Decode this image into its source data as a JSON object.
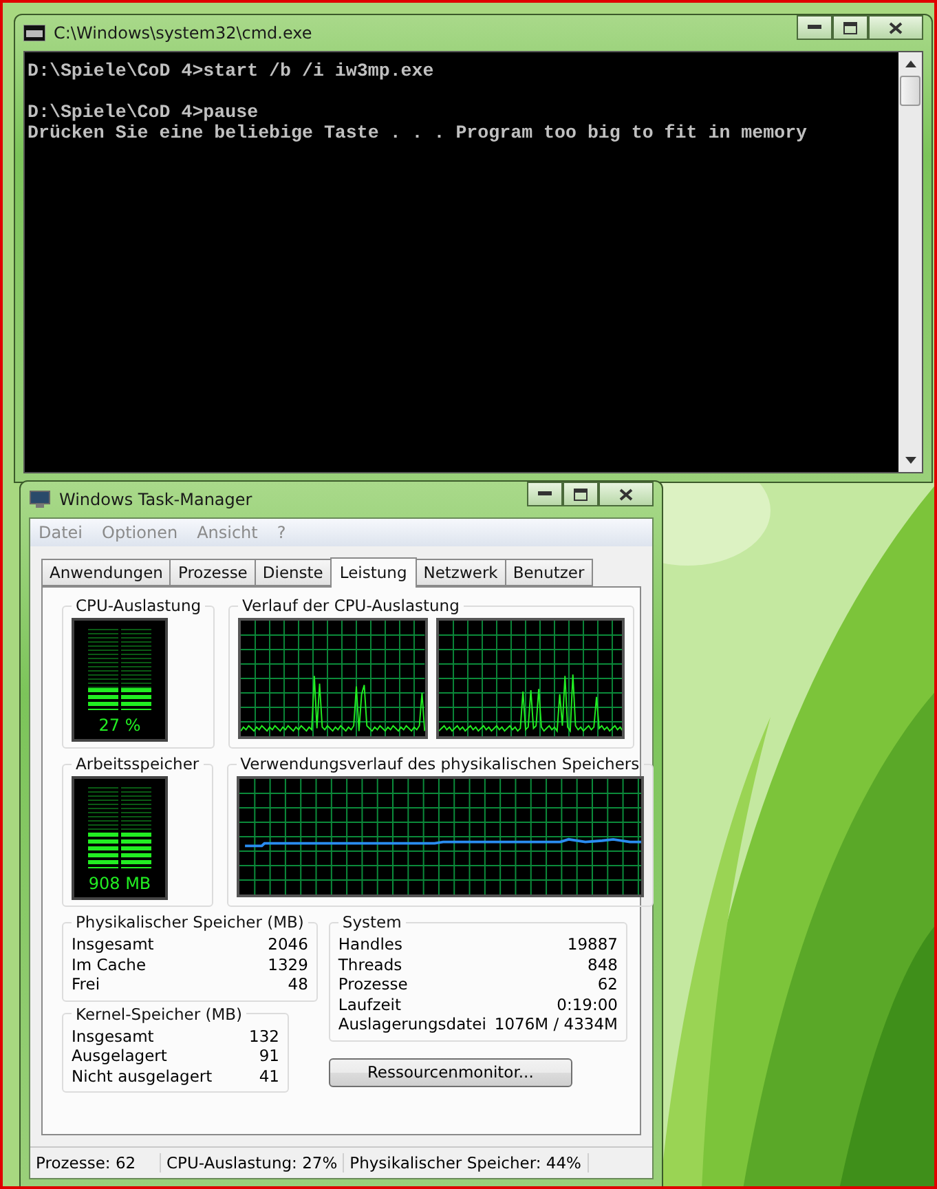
{
  "console": {
    "title": "C:\\Windows\\system32\\cmd.exe",
    "blocks": [
      [
        "D:\\Spiele\\CoD 4>start /b /i iw3mp.exe"
      ],
      [
        "D:\\Spiele\\CoD 4>pause",
        "Drücken Sie eine beliebige Taste . . . Program too big to fit in memory"
      ]
    ]
  },
  "task_manager": {
    "title": "Windows Task-Manager",
    "menu": [
      "Datei",
      "Optionen",
      "Ansicht",
      "?"
    ],
    "tabs": [
      {
        "label": "Anwendungen",
        "selected": false
      },
      {
        "label": "Prozesse",
        "selected": false
      },
      {
        "label": "Dienste",
        "selected": false
      },
      {
        "label": "Leistung",
        "selected": true
      },
      {
        "label": "Netzwerk",
        "selected": false
      },
      {
        "label": "Benutzer",
        "selected": false
      }
    ],
    "cpu_meter": {
      "title": "CPU-Auslastung",
      "reading": "27 %",
      "level": 0.27
    },
    "cpu_history": {
      "title": "Verlauf der CPU-Auslastung"
    },
    "memory_meter": {
      "title": "Arbeitsspeicher",
      "reading": "908 MB",
      "level": 0.44
    },
    "memory_history": {
      "title": "Verwendungsverlauf des physikalischen Speichers"
    },
    "physical_memory": {
      "title": "Physikalischer Speicher (MB)",
      "rows": [
        [
          "Insgesamt",
          "2046"
        ],
        [
          "Im Cache",
          "1329"
        ],
        [
          "Frei",
          "48"
        ]
      ]
    },
    "kernel_memory": {
      "title": "Kernel-Speicher (MB)",
      "rows": [
        [
          "Insgesamt",
          "132"
        ],
        [
          "Ausgelagert",
          "91"
        ],
        [
          "Nicht ausgelagert",
          "41"
        ]
      ]
    },
    "system": {
      "title": "System",
      "rows": [
        [
          "Handles",
          "19887"
        ],
        [
          "Threads",
          "848"
        ],
        [
          "Prozesse",
          "62"
        ],
        [
          "Laufzeit",
          "0:19:00"
        ],
        [
          "Auslagerungsdatei",
          "1076M / 4334M"
        ]
      ]
    },
    "button": "Ressourcenmonitor...",
    "status_bar": [
      "Prozesse: 62",
      "CPU-Auslastung: 27%",
      "Physikalischer Speicher: 44%"
    ]
  }
}
